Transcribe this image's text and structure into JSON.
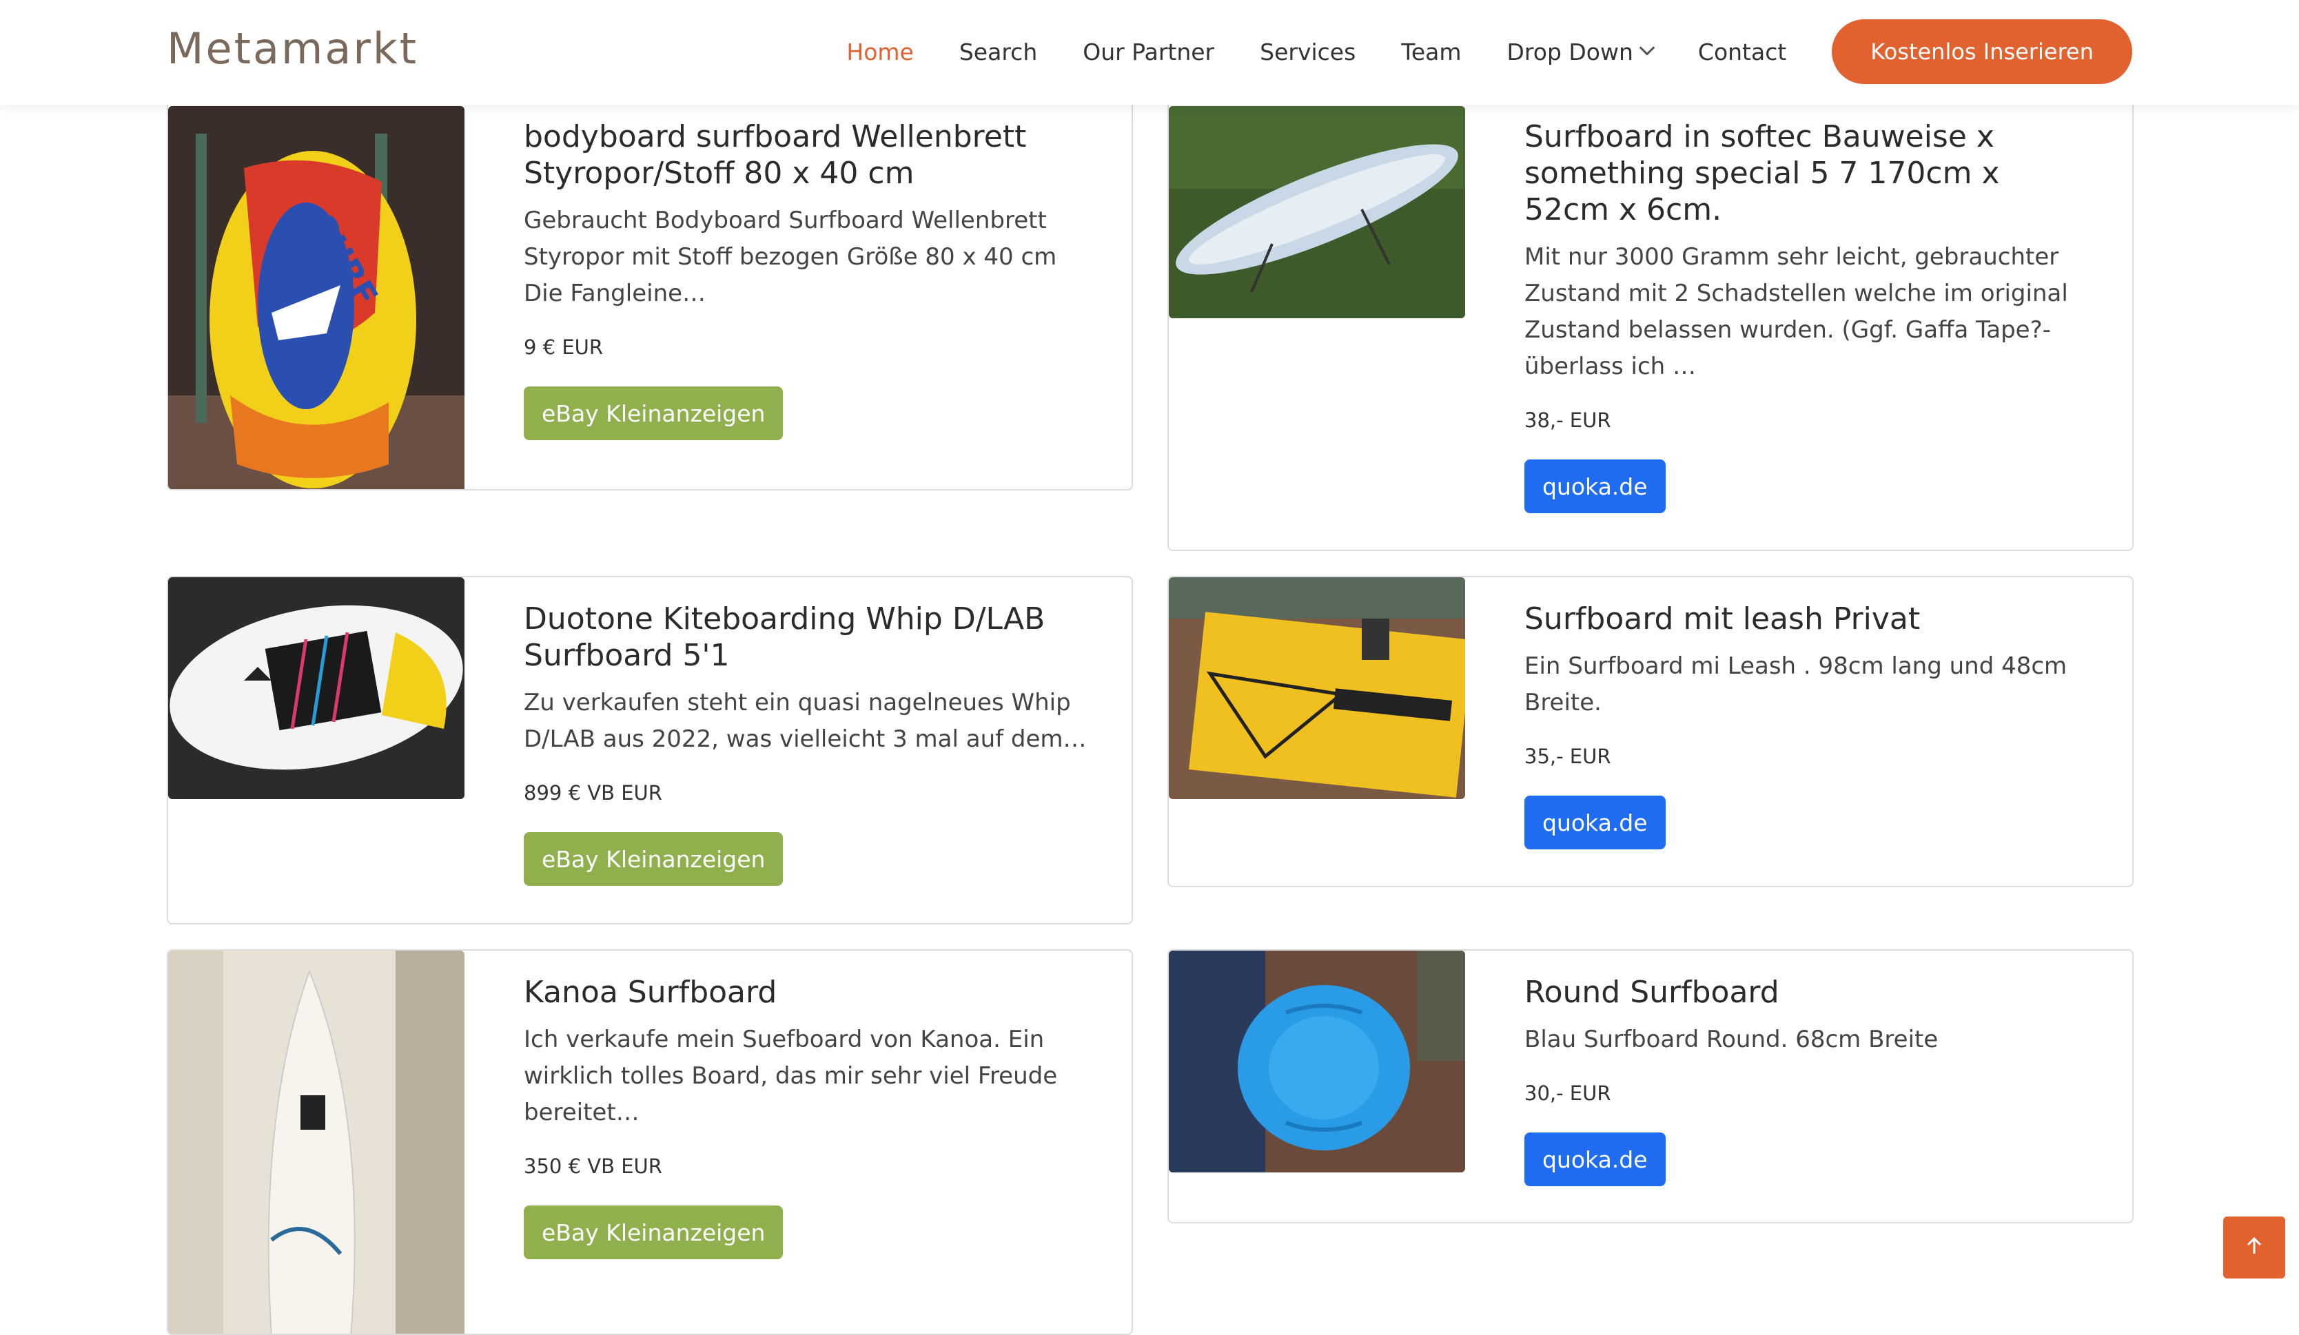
{
  "header": {
    "logo": "Metamarkt",
    "nav": [
      {
        "label": "Home",
        "active": true
      },
      {
        "label": "Search"
      },
      {
        "label": "Our Partner"
      },
      {
        "label": "Services"
      },
      {
        "label": "Team"
      },
      {
        "label": "Drop Down",
        "has_dropdown": true
      },
      {
        "label": "Contact"
      }
    ],
    "cta_label": "Kostenlos Inserieren"
  },
  "listings": [
    {
      "title": "bodyboard surfboard Wellenbrett Styropor/Stoff 80 x 40 cm",
      "description": "Gebraucht Bodyboard Surfboard Wellenbrett Styropor mit Stoff bezogen Größe 80 x 40 cm Die Fangleine…",
      "price": "9 € EUR",
      "source": "eBay Kleinanzeigen",
      "source_type": "ebay"
    },
    {
      "title": "Surfboard in softec Bauweise x something special 5 7 170cm x 52cm x 6cm.",
      "description": "Mit nur 3000 Gramm sehr leicht, gebrauchter Zustand mit 2 Schadstellen welche im original Zustand belassen wurden. (Ggf. Gaffa Tape?-überlass ich …",
      "price": "38,- EUR",
      "source": "quoka.de",
      "source_type": "quoka"
    },
    {
      "title": "Duotone Kiteboarding Whip D/LAB Surfboard 5'1",
      "description": "Zu verkaufen steht ein quasi nagelneues Whip D/LAB aus 2022, was vielleicht 3 mal auf dem…",
      "price": "899 € VB EUR",
      "source": "eBay Kleinanzeigen",
      "source_type": "ebay"
    },
    {
      "title": "Surfboard mit leash Privat",
      "description": "Ein Surfboard mi Leash . 98cm lang und 48cm Breite.",
      "price": "35,- EUR",
      "source": "quoka.de",
      "source_type": "quoka"
    },
    {
      "title": "Kanoa Surfboard",
      "description": "Ich verkaufe mein Suefboard von Kanoa. Ein wirklich tolles Board, das mir sehr viel Freude bereitet…",
      "price": "350 € VB EUR",
      "source": "eBay Kleinanzeigen",
      "source_type": "ebay"
    },
    {
      "title": "Round Surfboard",
      "description": "Blau Surfboard Round. 68cm Breite",
      "price": "30,- EUR",
      "source": "quoka.de",
      "source_type": "quoka"
    }
  ],
  "icons": {
    "dropdown": "chevron-down-icon",
    "scroll_top": "arrow-up-icon"
  },
  "colors": {
    "accent": "#e2622f",
    "ebay": "#8fb04d",
    "quoka": "#1f6cf0"
  }
}
